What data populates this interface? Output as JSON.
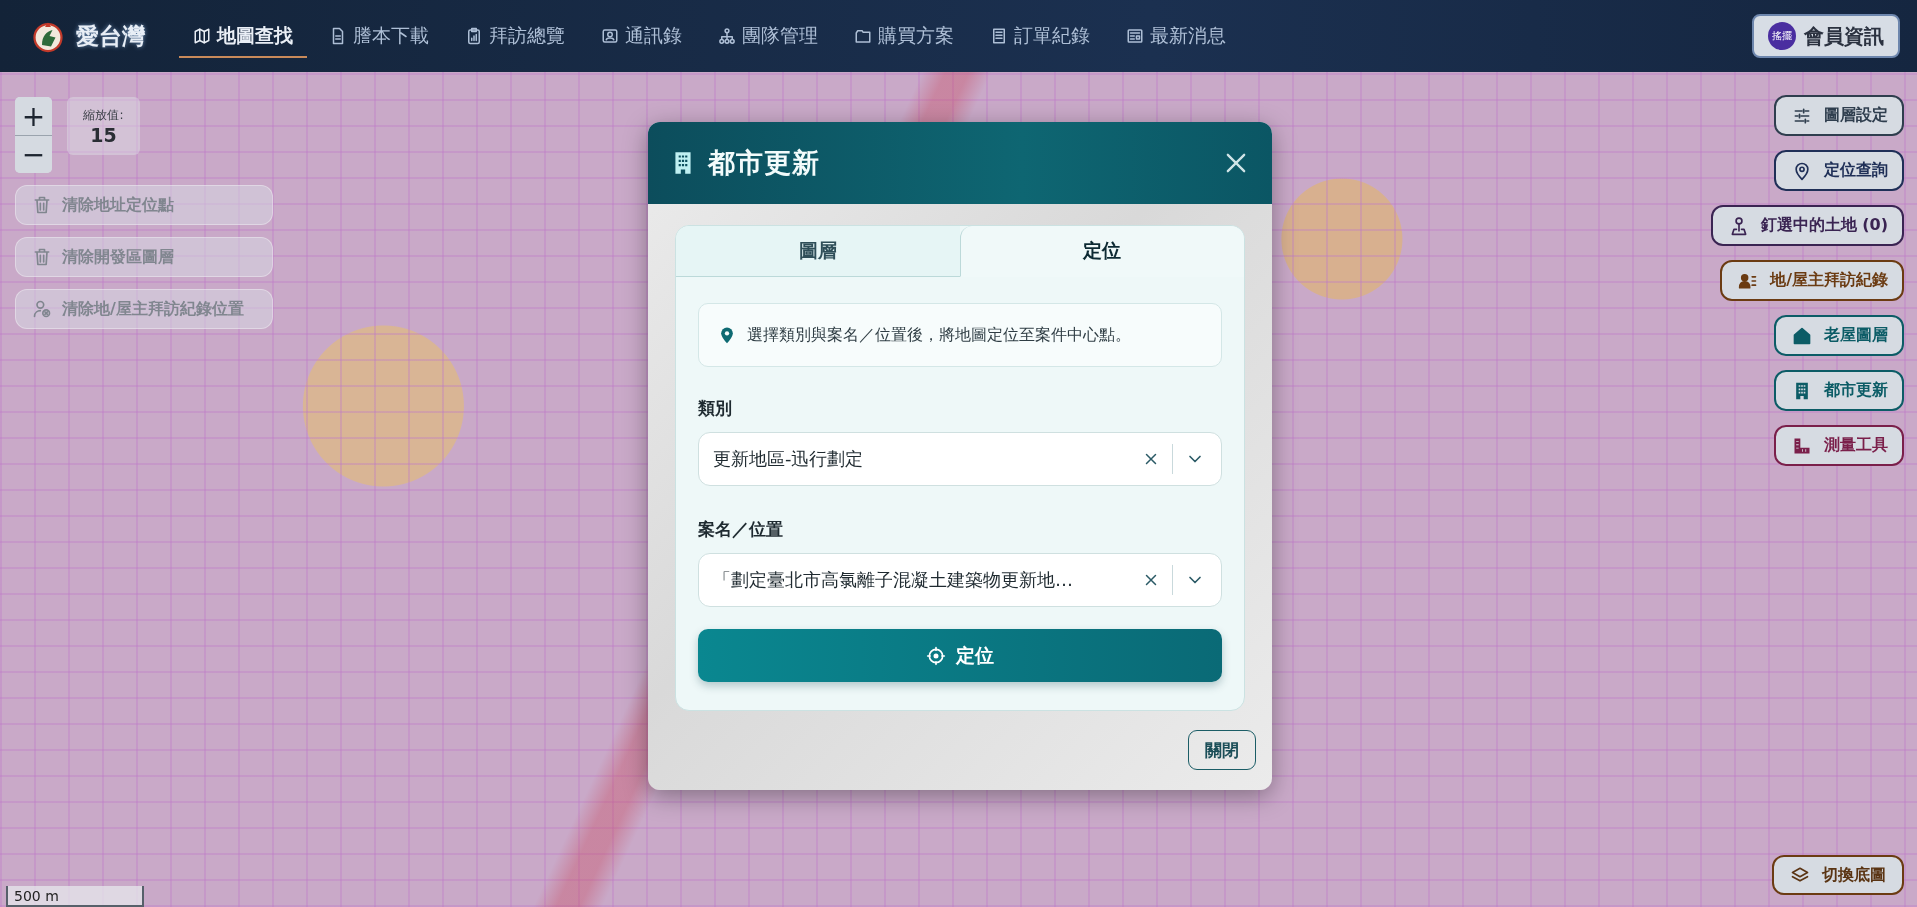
{
  "header": {
    "brand": "愛台灣",
    "nav": [
      {
        "label": "地圖查找",
        "selected": true
      },
      {
        "label": "謄本下載",
        "selected": false
      },
      {
        "label": "拜訪總覽",
        "selected": false
      },
      {
        "label": "通訊錄",
        "selected": false
      },
      {
        "label": "團隊管理",
        "selected": false
      },
      {
        "label": "購買方案",
        "selected": false
      },
      {
        "label": "訂單紀錄",
        "selected": false
      },
      {
        "label": "最新消息",
        "selected": false
      }
    ],
    "member_button": {
      "avatar_text": "搖擺",
      "label": "會員資訊"
    }
  },
  "map": {
    "zoom_in": "+",
    "zoom_out": "−",
    "zoom_label": "縮放值:",
    "zoom_value": "15",
    "left_actions": [
      {
        "label": "清除地址定位點",
        "disabled": true
      },
      {
        "label": "清除開發區圖層",
        "disabled": true
      },
      {
        "label": "清除地/屋主拜訪紀錄位置",
        "disabled": true
      }
    ],
    "right_actions": [
      {
        "label": "圖層設定",
        "color": "#2f3e4e"
      },
      {
        "label": "定位查詢",
        "color": "#1f2f57"
      },
      {
        "label": "釘選中的土地 (0)",
        "color": "#3a2452"
      },
      {
        "label": "地/屋主拜訪紀錄",
        "color": "#6b3b12"
      },
      {
        "label": "老屋圖層",
        "color": "#0c5c66"
      },
      {
        "label": "都市更新",
        "color": "#0c5c66"
      },
      {
        "label": "測量工具",
        "color": "#7a1f4a"
      }
    ],
    "basemap_button": "切換底圖",
    "scale": "500 m"
  },
  "dialog": {
    "title": "都市更新",
    "tabs": [
      {
        "label": "圖層",
        "selected": false
      },
      {
        "label": "定位",
        "selected": true
      }
    ],
    "hint": "選擇類別與案名／位置後，將地圖定位至案件中心點。",
    "fields": [
      {
        "label": "類別",
        "value": "更新地區-迅行劃定"
      },
      {
        "label": "案名／位置",
        "value": "「劃定臺北市高氯離子混凝土建築物更新地…"
      }
    ],
    "locate_button": "定位",
    "close_button": "關閉"
  }
}
